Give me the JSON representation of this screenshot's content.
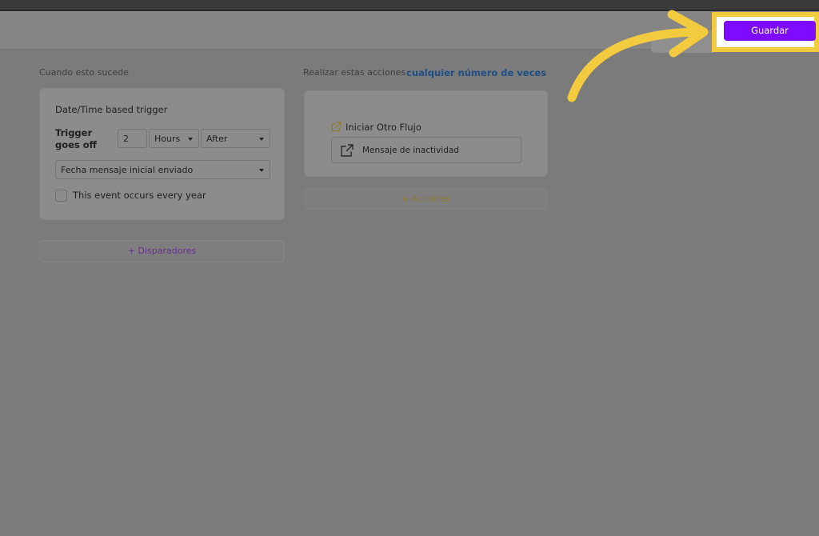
{
  "header": {
    "save_label": "Guardar"
  },
  "trigger_column": {
    "label": "Cuando esto sucede",
    "card": {
      "title": "Date/Time based trigger",
      "goes_off_label": "Trigger goes off",
      "amount_value": "2",
      "unit_value": "Hours",
      "direction_value": "After",
      "field_value": "Fecha mensaje inicial enviado",
      "yearly_label": "This event occurs every year",
      "yearly_checked": false
    },
    "add_label": "+ Disparadores"
  },
  "action_column": {
    "label": "Realizar estas acciones",
    "repeat_link": "cualquier número de veces",
    "card": {
      "action_title": "Iniciar Otro Flujo",
      "flow_name": "Mensaje de inactividad"
    },
    "add_label": "+ Acciones"
  },
  "colors": {
    "save_button": "#7d0bff",
    "highlight": "#f2cb3f",
    "link": "#1d4f86",
    "overlay": "#7b7b7b"
  },
  "icons": {
    "flow": "external-link-icon",
    "flow_item": "external-link-icon",
    "annotation": "curved-arrow-icon"
  }
}
